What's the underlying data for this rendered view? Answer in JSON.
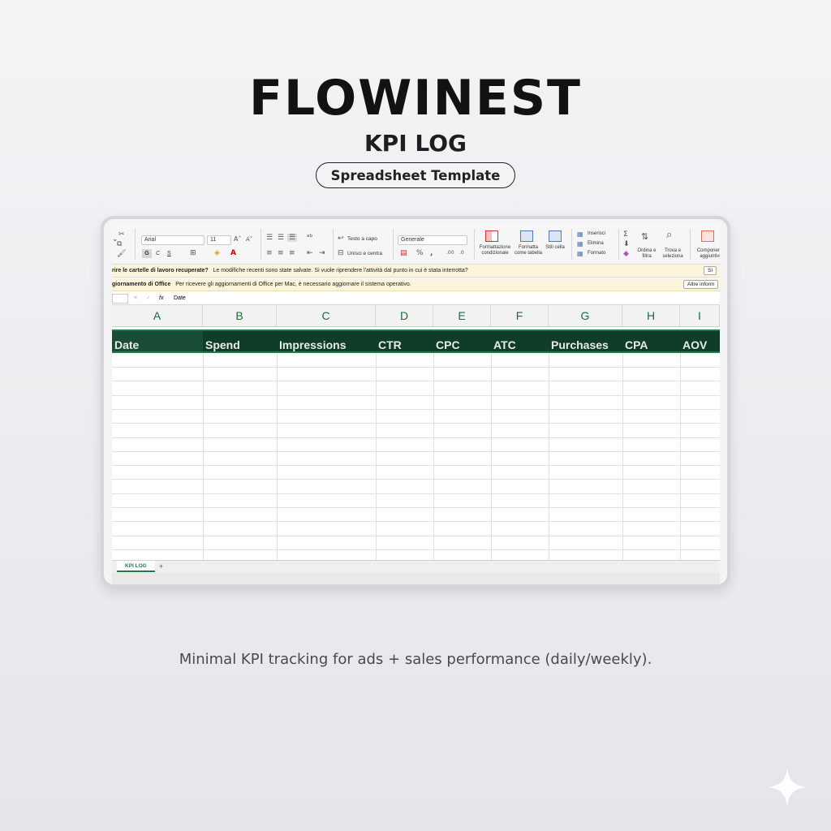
{
  "brand": "FLOWINEST",
  "subtitle": "KPI LOG",
  "badge": "Spreadsheet Template",
  "tagline": "Minimal KPI tracking for ads + sales performance (daily/weekly).",
  "ribbon": {
    "font": "Arial",
    "size": "11",
    "bold": "G",
    "italic": "C",
    "underline": "S",
    "wrap_text": "Testo a capo",
    "merge_center": "Unisci e centra",
    "number_format": "Generale",
    "conditional_formatting": "Formattazione condizionale",
    "format_as_table": "Formatta come tabella",
    "cell_styles": "Stili cella",
    "insert": "Inserisci",
    "delete": "Elimina",
    "format": "Formato",
    "sort_filter": "Ordina e filtra",
    "find_select": "Trova e seleziona",
    "addins": "Componenti aggiuntivi"
  },
  "notifications": {
    "recovered_title": "rire le cartelle di lavoro recuperate?",
    "recovered_text": "Le modifiche recenti sono state salvate. Si vuole riprendere l'attività dal punto in cui è stata interrotta?",
    "recovered_button": "Sì",
    "update_title": "giornamento di Office",
    "update_text": "Per ricevere gli aggiornamenti di Office per Mac, è necessario aggiornare il sistema operativo.",
    "update_button": "Altre inform"
  },
  "formula_bar": {
    "fx": "fx",
    "value": "Date"
  },
  "columns": [
    "A",
    "B",
    "C",
    "D",
    "E",
    "F",
    "G",
    "H",
    "I"
  ],
  "headers": [
    "Date",
    "Spend",
    "Impressions",
    "CTR",
    "CPC",
    "ATC",
    "Purchases",
    "CPA",
    "AOV"
  ],
  "sheet_tab": "KPI LOG",
  "add_sheet": "+",
  "colors": {
    "header_bg": "#0f3d2a",
    "accent": "#1e7a4b",
    "header_text": "#e8ece9"
  }
}
